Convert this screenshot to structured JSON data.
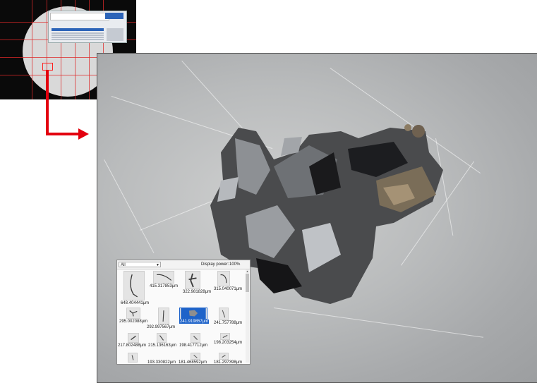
{
  "gallery": {
    "filter_value": "All",
    "power_label": "Display power:",
    "power_value": "100%",
    "items": [
      {
        "label": "648.404441μm"
      },
      {
        "label": "415.317853μm"
      },
      {
        "label": "322.981828μm"
      },
      {
        "label": "315.040071μm"
      },
      {
        "label": "295.002088μm"
      },
      {
        "label": "292.997567μm"
      },
      {
        "label": "241.919857μm",
        "selected": true
      },
      {
        "label": "241.757788μm"
      },
      {
        "label": "217.802488μm"
      },
      {
        "label": "215.136163μm"
      },
      {
        "label": "198.417712μm"
      },
      {
        "label": "198.203254μm"
      },
      {
        "label": "193.330822μm"
      },
      {
        "label": "181.468592μm"
      },
      {
        "label": "181.297398μm"
      }
    ]
  },
  "colors": {
    "accent": "#1e63c9",
    "arrow": "#e3000f",
    "overview_grid": "#dc2828"
  }
}
